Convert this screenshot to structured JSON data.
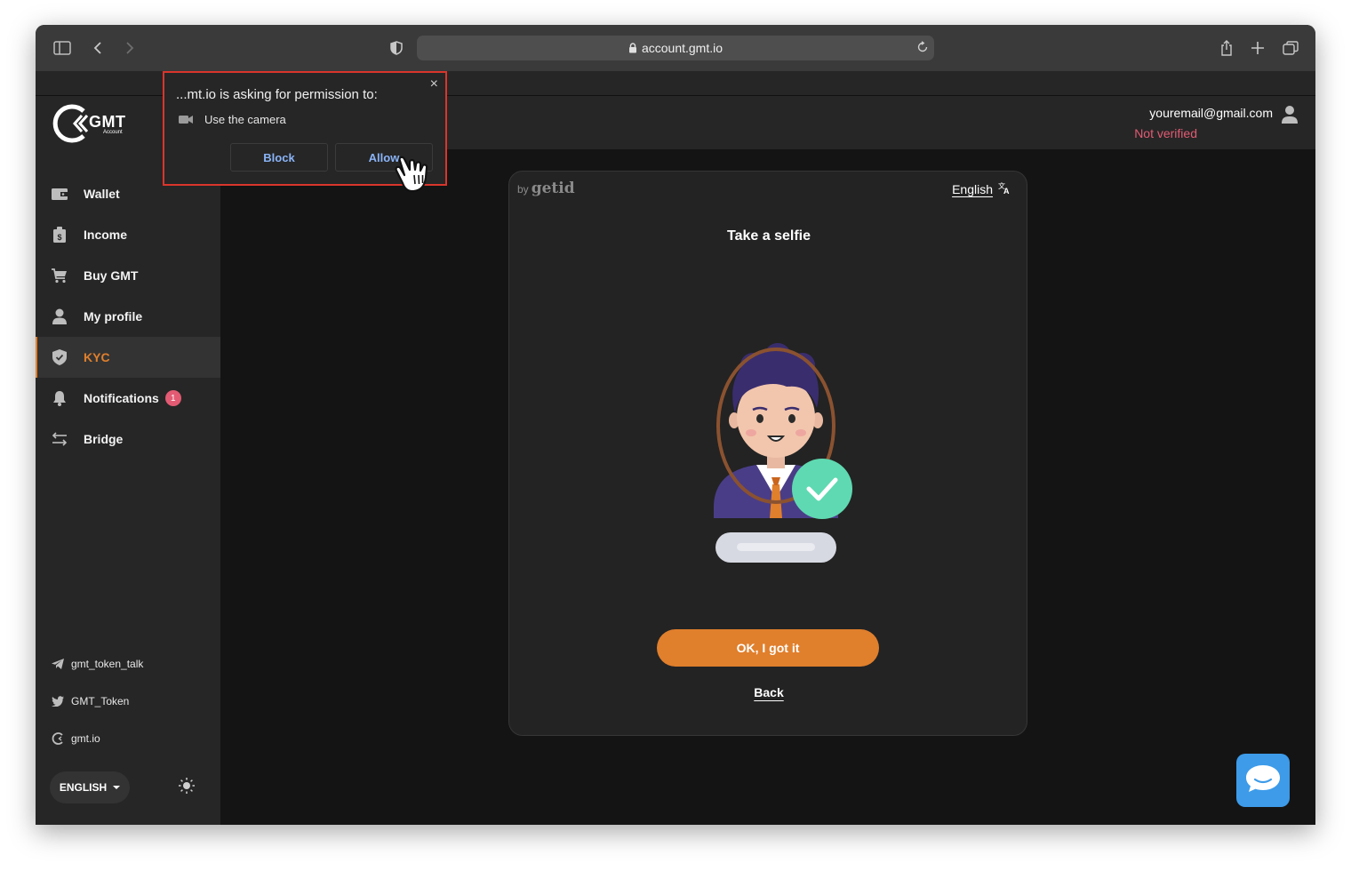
{
  "browser": {
    "url": "account.gmt.io"
  },
  "logo": {
    "text": "GMT",
    "sub": "Account"
  },
  "sidebar": {
    "items": [
      {
        "label": "Wallet",
        "icon": "wallet-icon"
      },
      {
        "label": "Income",
        "icon": "income-icon"
      },
      {
        "label": "Buy GMT",
        "icon": "cart-icon"
      },
      {
        "label": "My profile",
        "icon": "user-icon"
      },
      {
        "label": "KYC",
        "icon": "shield-icon",
        "active": true
      },
      {
        "label": "Notifications",
        "icon": "bell-icon",
        "badge": "1"
      },
      {
        "label": "Bridge",
        "icon": "swap-icon"
      }
    ],
    "social": [
      {
        "label": "gmt_token_talk",
        "icon": "telegram-icon"
      },
      {
        "label": "GMT_Token",
        "icon": "twitter-icon"
      },
      {
        "label": "gmt.io",
        "icon": "gmt-icon"
      }
    ],
    "language": "ENGLISH"
  },
  "header": {
    "email": "youremail@gmail.com",
    "status": "Not verified"
  },
  "card": {
    "provider_prefix": "by",
    "provider": "getid",
    "language": "English",
    "title": "Take a selfie",
    "ok_label": "OK, I got it",
    "back_label": "Back"
  },
  "permission_popup": {
    "title": "...mt.io is asking for permission to:",
    "request": "Use the camera",
    "close": "×",
    "block_label": "Block",
    "allow_label": "Allow"
  },
  "colors": {
    "accent": "#e07f2c",
    "danger": "#e25b73",
    "check": "#5fd9b1",
    "chat": "#3d9be9",
    "link": "#8ab4f8"
  }
}
